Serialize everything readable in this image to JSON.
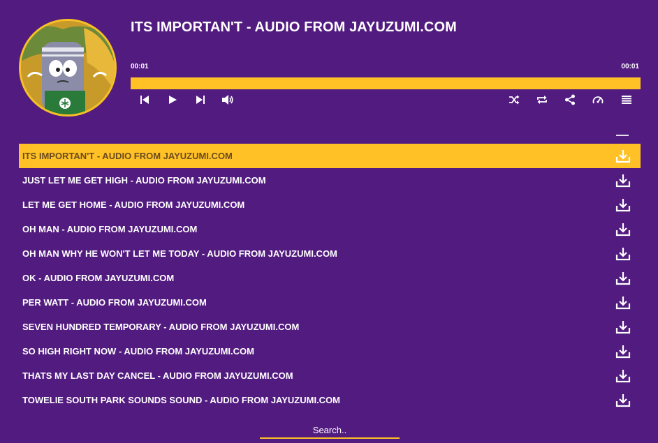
{
  "player": {
    "title": "ITS IMPORTAN'T - AUDIO FROM JAYUZUMI.COM",
    "current_time": "00:01",
    "duration": "00:01",
    "progress_fraction": 1.0,
    "accent_color": "#ffc125",
    "background_color": "#521b80",
    "controls_left": [
      "skip-back-icon",
      "play-icon",
      "skip-forward-icon",
      "volume-icon"
    ],
    "controls_right": [
      "shuffle-icon",
      "repeat-icon",
      "share-icon",
      "speed-icon",
      "playlist-icon"
    ]
  },
  "playlist": {
    "active_index": 0,
    "tracks": [
      {
        "title": "ITS IMPORTAN'T - AUDIO FROM JAYUZUMI.COM"
      },
      {
        "title": "JUST LET ME GET HIGH - AUDIO FROM JAYUZUMI.COM"
      },
      {
        "title": "LET ME GET HOME - AUDIO FROM JAYUZUMI.COM"
      },
      {
        "title": "OH MAN - AUDIO FROM JAYUZUMI.COM"
      },
      {
        "title": "OH MAN WHY HE WON'T LET ME TODAY - AUDIO FROM JAYUZUMI.COM"
      },
      {
        "title": "OK - AUDIO FROM JAYUZUMI.COM"
      },
      {
        "title": "PER WATT - AUDIO FROM JAYUZUMI.COM"
      },
      {
        "title": "SEVEN HUNDRED TEMPORARY - AUDIO FROM JAYUZUMI.COM"
      },
      {
        "title": "SO HIGH RIGHT NOW - AUDIO FROM JAYUZUMI.COM"
      },
      {
        "title": "THATS MY LAST DAY CANCEL - AUDIO FROM JAYUZUMI.COM"
      },
      {
        "title": "TOWELIE SOUTH PARK SOUNDS SOUND - AUDIO FROM JAYUZUMI.COM"
      }
    ]
  },
  "search": {
    "placeholder": "Search.."
  }
}
